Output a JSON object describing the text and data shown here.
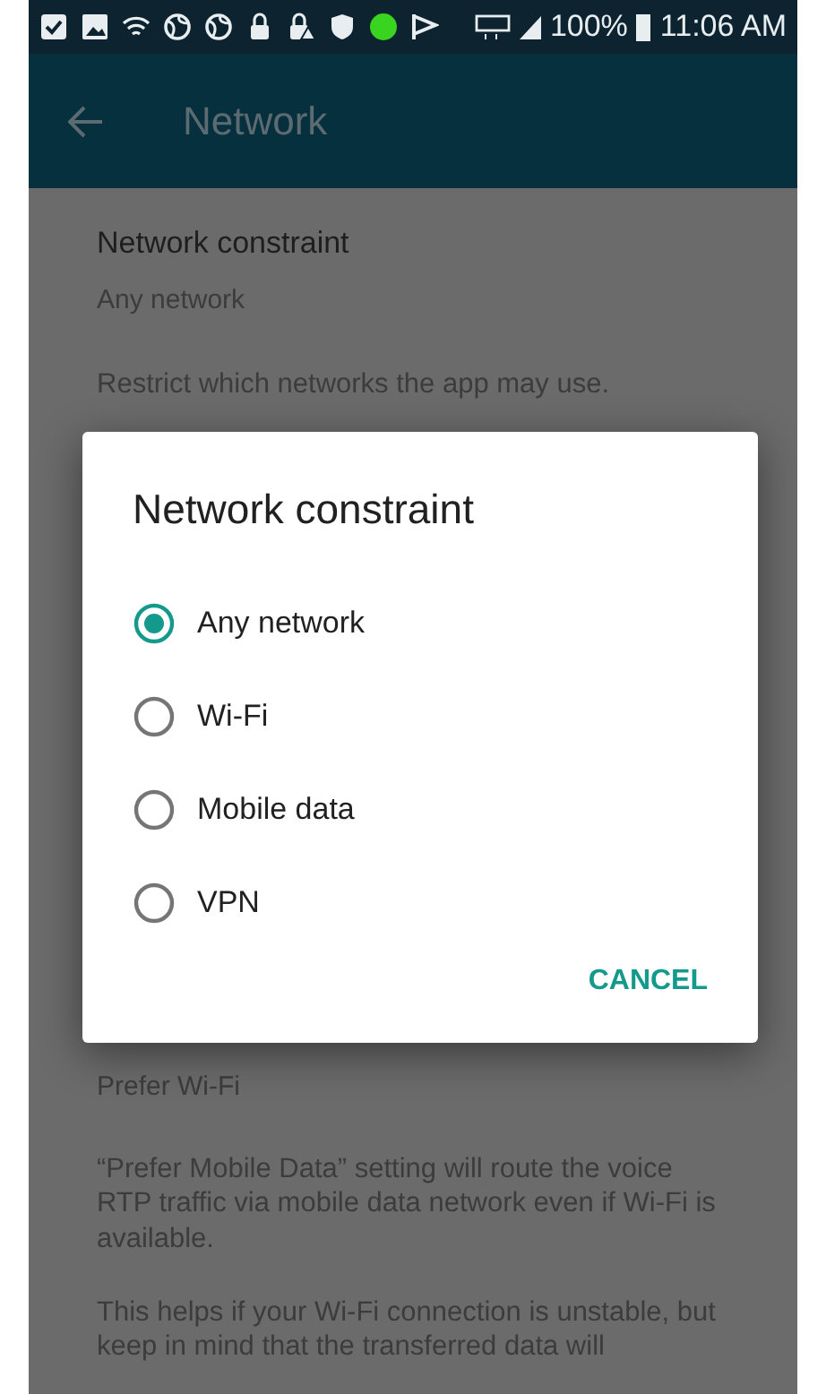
{
  "status_bar": {
    "battery": "100%",
    "time": "11:06 AM"
  },
  "app_bar": {
    "title": "Network"
  },
  "settings": [
    {
      "title": "Network constraint",
      "summary": "Any network",
      "description": "Restrict which networks the app may use."
    },
    {
      "summary": "Prefer Wi-Fi",
      "description": "“Prefer Mobile Data” setting will route the voice RTP traffic via mobile data network even if Wi-Fi is available.",
      "note": "This helps if your Wi-Fi connection is unstable, but keep in mind that the transferred data will"
    }
  ],
  "dialog": {
    "title": "Network constraint",
    "options": [
      {
        "label": "Any network",
        "selected": true
      },
      {
        "label": "Wi-Fi",
        "selected": false
      },
      {
        "label": "Mobile data",
        "selected": false
      },
      {
        "label": "VPN",
        "selected": false
      }
    ],
    "buttons": [
      "CANCEL"
    ]
  }
}
